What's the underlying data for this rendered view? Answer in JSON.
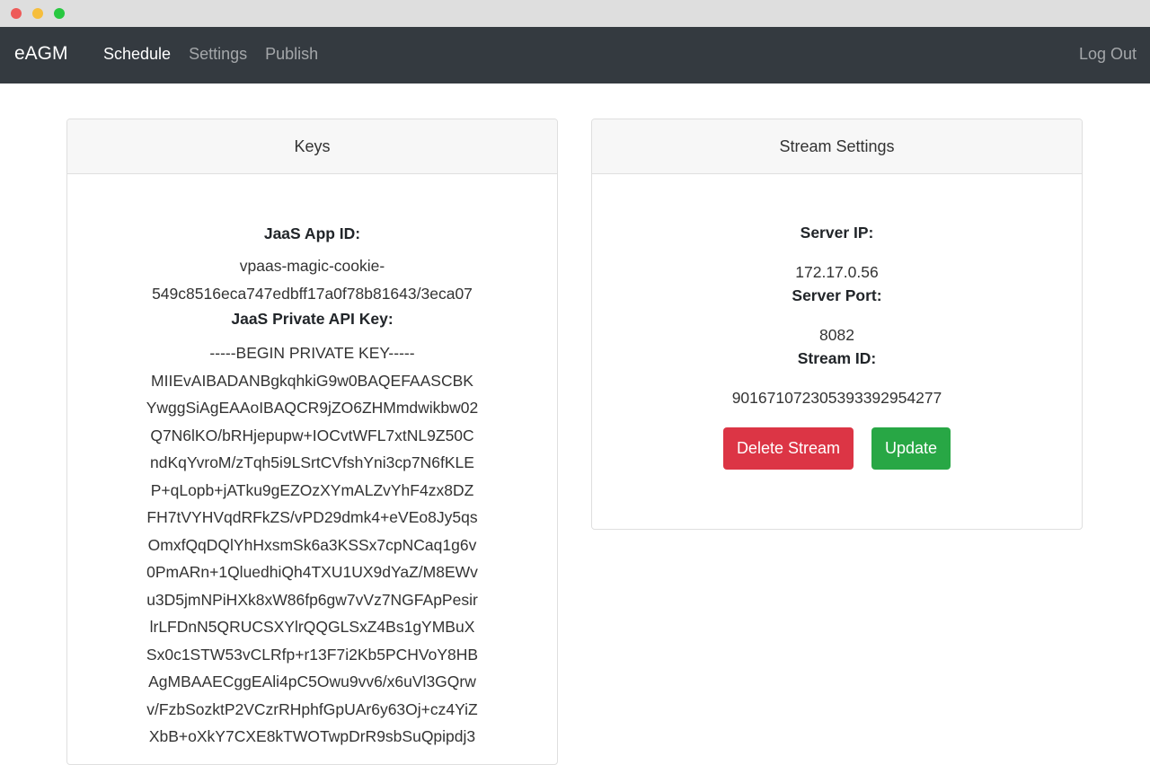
{
  "navbar": {
    "brand": "eAGM",
    "links": [
      {
        "label": "Schedule",
        "active": true
      },
      {
        "label": "Settings",
        "active": false
      },
      {
        "label": "Publish",
        "active": false
      }
    ],
    "logout": "Log Out"
  },
  "keys": {
    "title": "Keys",
    "app_id_label": "JaaS App ID:",
    "app_id_lines": [
      "vpaas-magic-cookie-",
      "549c8516eca747edbff17a0f78b81643/3eca07"
    ],
    "private_key_label": "JaaS Private API Key:",
    "private_key_lines": [
      "-----BEGIN PRIVATE KEY-----",
      "MIIEvAIBADANBgkqhkiG9w0BAQEFAASCBK",
      "YwggSiAgEAAoIBAQCR9jZO6ZHMmdwikbw02",
      "Q7N6lKO/bRHjepupw+IOCvtWFL7xtNL9Z50C",
      "ndKqYvroM/zTqh5i9LSrtCVfshYni3cp7N6fKLE",
      "P+qLopb+jATku9gEZOzXYmALZvYhF4zx8DZ",
      "FH7tVYHVqdRFkZS/vPD29dmk4+eVEo8Jy5qs",
      "OmxfQqDQlYhHxsmSk6a3KSSx7cpNCaq1g6v",
      "0PmARn+1QluedhiQh4TXU1UX9dYaZ/M8EWv",
      "u3D5jmNPiHXk8xW86fp6gw7vVz7NGFApPesir",
      "lrLFDnN5QRUCSXYlrQQGLSxZ4Bs1gYMBuX",
      "Sx0c1STW53vCLRfp+r13F7i2Kb5PCHVoY8HB",
      "AgMBAAECggEAli4pC5Owu9vv6/x6uVl3GQrw",
      "v/FzbSozktP2VCzrRHphfGpUAr6y63Oj+cz4YiZ",
      "XbB+oXkY7CXE8kTWOTwpDrR9sbSuQpipdj3"
    ]
  },
  "stream": {
    "title": "Stream Settings",
    "server_ip_label": "Server IP:",
    "server_ip": "172.17.0.56",
    "server_port_label": "Server Port:",
    "server_port": "8082",
    "stream_id_label": "Stream ID:",
    "stream_id": "901671072305393392954277",
    "delete_label": "Delete Stream",
    "update_label": "Update"
  },
  "colors": {
    "navbar_bg": "#343a40",
    "danger": "#dc3545",
    "success": "#28a745"
  },
  "icons": [
    "window-close-dot",
    "window-minimize-dot",
    "window-maximize-dot"
  ]
}
